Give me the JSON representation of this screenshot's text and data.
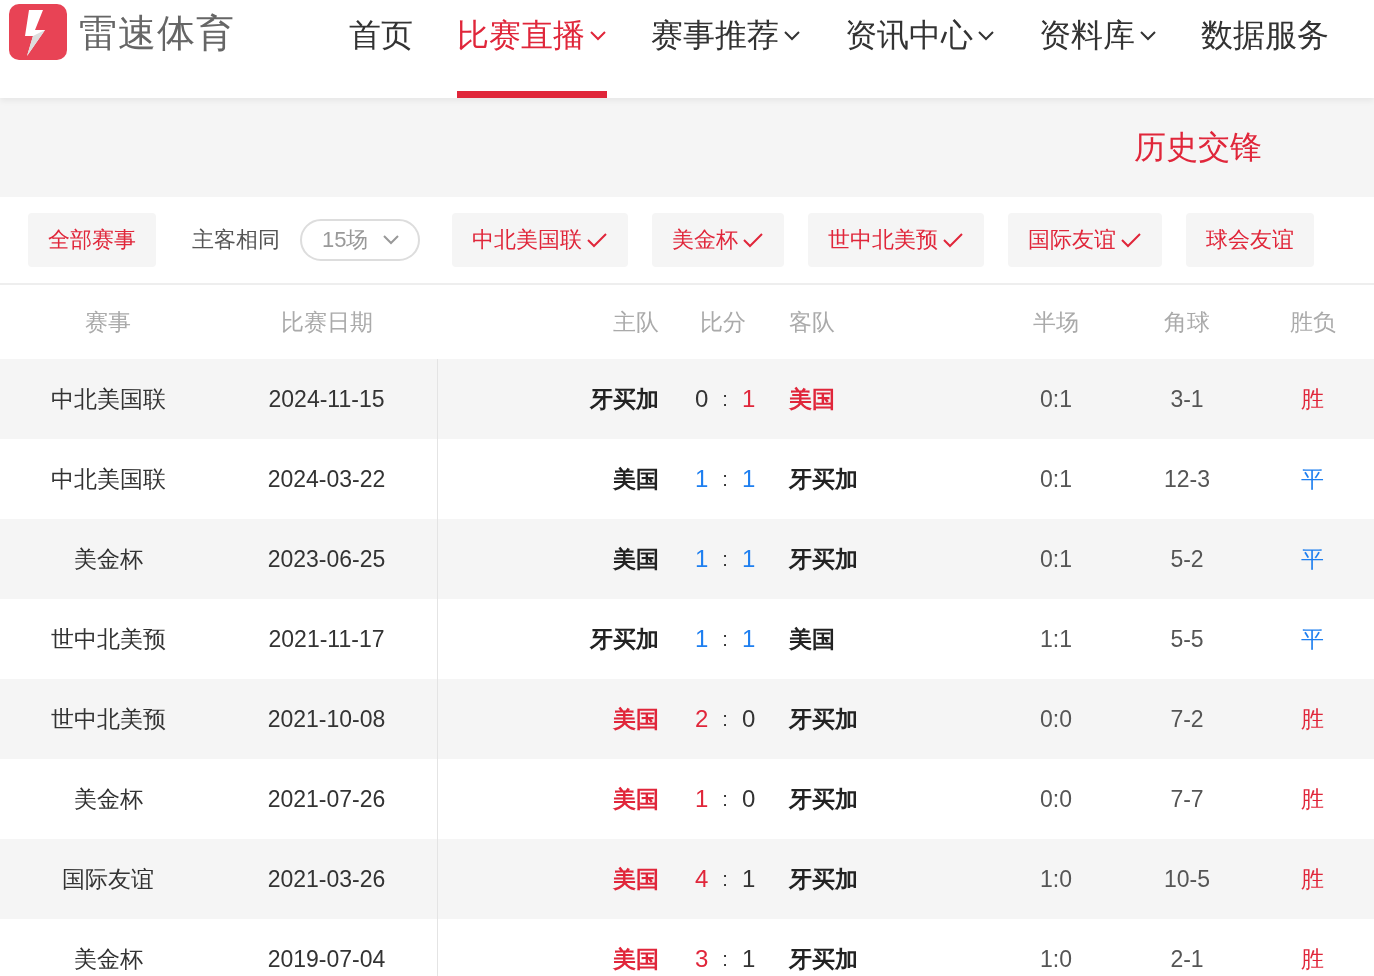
{
  "brand": {
    "name": "雷速体育"
  },
  "nav": [
    {
      "label": "首页",
      "selected": false,
      "dropdown": false
    },
    {
      "label": "比赛直播",
      "selected": true,
      "dropdown": true
    },
    {
      "label": "赛事推荐",
      "selected": false,
      "dropdown": true
    },
    {
      "label": "资讯中心",
      "selected": false,
      "dropdown": true
    },
    {
      "label": "资料库",
      "selected": false,
      "dropdown": true
    },
    {
      "label": "数据服务",
      "selected": false,
      "dropdown": false
    }
  ],
  "section_title": "历史交锋",
  "filters": {
    "all": "全部赛事",
    "same_home_label": "主客相同",
    "count_select": "15场",
    "tags": [
      {
        "label": "中北美国联",
        "checked": true
      },
      {
        "label": "美金杯",
        "checked": true
      },
      {
        "label": "世中北美预",
        "checked": true
      },
      {
        "label": "国际友谊",
        "checked": true
      },
      {
        "label": "球会友谊",
        "checked": false
      }
    ]
  },
  "table": {
    "columns": [
      "赛事",
      "比赛日期",
      "主队",
      "比分",
      "客队",
      "半场",
      "角球",
      "胜负"
    ],
    "rows": [
      {
        "competition": "中北美国联",
        "date": "2024-11-15",
        "home": "牙买加",
        "home_score": "0",
        "separator": ":",
        "away_score": "1",
        "away": "美国",
        "home_won": false,
        "away_won": true,
        "draw": false,
        "half": "0:1",
        "corners": "3-1",
        "result": "胜"
      },
      {
        "competition": "中北美国联",
        "date": "2024-03-22",
        "home": "美国",
        "home_score": "1",
        "separator": ":",
        "away_score": "1",
        "away": "牙买加",
        "home_won": false,
        "away_won": false,
        "draw": true,
        "half": "0:1",
        "corners": "12-3",
        "result": "平"
      },
      {
        "competition": "美金杯",
        "date": "2023-06-25",
        "home": "美国",
        "home_score": "1",
        "separator": ":",
        "away_score": "1",
        "away": "牙买加",
        "home_won": false,
        "away_won": false,
        "draw": true,
        "half": "0:1",
        "corners": "5-2",
        "result": "平"
      },
      {
        "competition": "世中北美预",
        "date": "2021-11-17",
        "home": "牙买加",
        "home_score": "1",
        "separator": ":",
        "away_score": "1",
        "away": "美国",
        "home_won": false,
        "away_won": false,
        "draw": true,
        "half": "1:1",
        "corners": "5-5",
        "result": "平"
      },
      {
        "competition": "世中北美预",
        "date": "2021-10-08",
        "home": "美国",
        "home_score": "2",
        "separator": ":",
        "away_score": "0",
        "away": "牙买加",
        "home_won": true,
        "away_won": false,
        "draw": false,
        "half": "0:0",
        "corners": "7-2",
        "result": "胜"
      },
      {
        "competition": "美金杯",
        "date": "2021-07-26",
        "home": "美国",
        "home_score": "1",
        "separator": ":",
        "away_score": "0",
        "away": "牙买加",
        "home_won": true,
        "away_won": false,
        "draw": false,
        "half": "0:0",
        "corners": "7-7",
        "result": "胜"
      },
      {
        "competition": "国际友谊",
        "date": "2021-03-26",
        "home": "美国",
        "home_score": "4",
        "separator": ":",
        "away_score": "1",
        "away": "牙买加",
        "home_won": true,
        "away_won": false,
        "draw": false,
        "half": "1:0",
        "corners": "10-5",
        "result": "胜"
      },
      {
        "competition": "美金杯",
        "date": "2019-07-04",
        "home": "美国",
        "home_score": "3",
        "separator": ":",
        "away_score": "1",
        "away": "牙买加",
        "home_won": true,
        "away_won": false,
        "draw": false,
        "half": "1:0",
        "corners": "2-1",
        "result": "胜"
      }
    ]
  }
}
